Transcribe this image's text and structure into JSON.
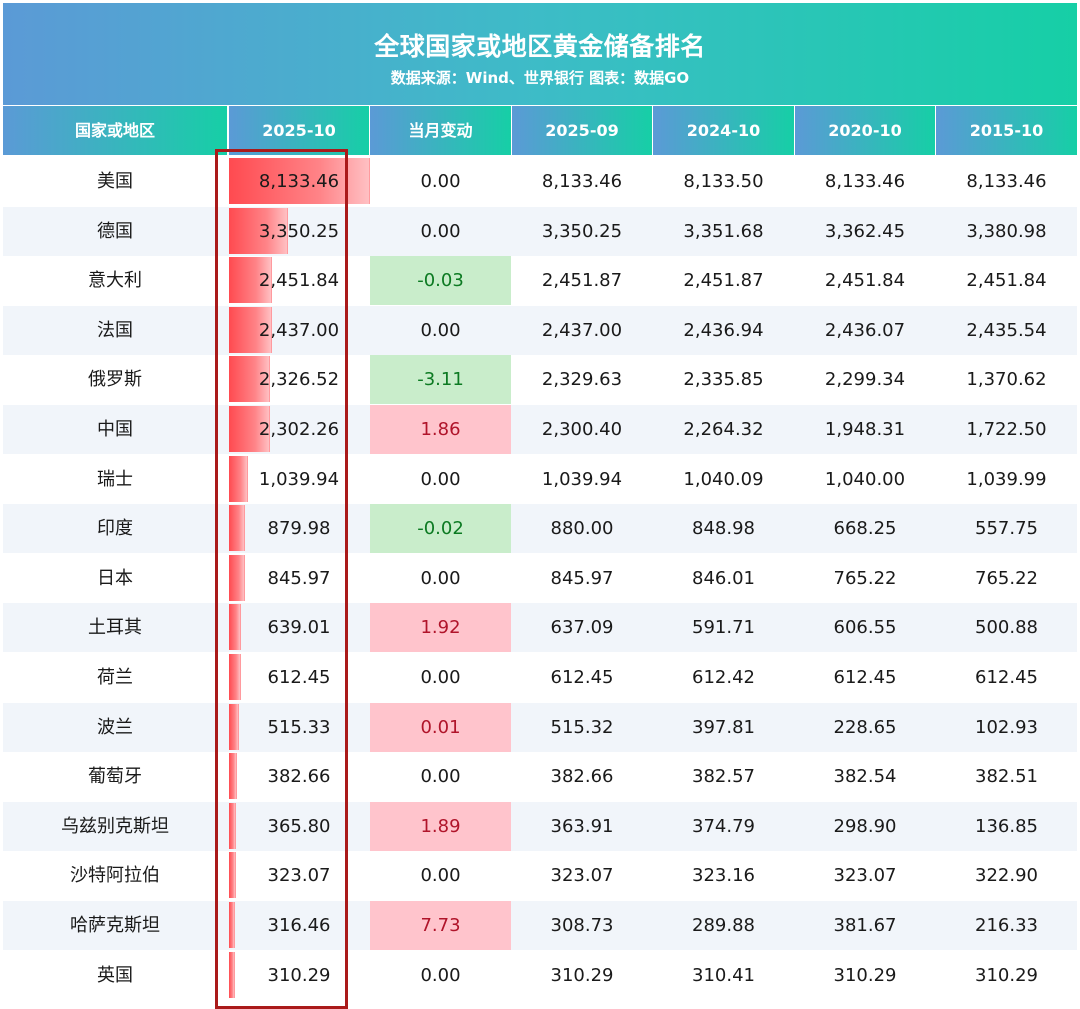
{
  "title": "全球国家或地区黄金储备排名",
  "subtitle": "数据来源：Wind、世界银行 图表：数据GO",
  "colors": {
    "header_gradient_start": "#5b9ad6",
    "header_gradient_end": "#16cfa6",
    "bar": "#ff4a50",
    "positive_change_bg": "#ffc4cc",
    "negative_change_bg": "#c9edcb",
    "highlight_outline": "#aa1a1a"
  },
  "chart_data": {
    "type": "table",
    "columns": [
      "国家或地区",
      "2025-10",
      "当月变动",
      "2025-09",
      "2024-10",
      "2020-10",
      "2015-10"
    ],
    "rows": [
      {
        "country": "美国",
        "v2025_10": "8,133.46",
        "change": "0.00",
        "v2025_09": "8,133.46",
        "v2024_10": "8,133.50",
        "v2020_10": "8,133.46",
        "v2015_10": "8,133.46"
      },
      {
        "country": "德国",
        "v2025_10": "3,350.25",
        "change": "0.00",
        "v2025_09": "3,350.25",
        "v2024_10": "3,351.68",
        "v2020_10": "3,362.45",
        "v2015_10": "3,380.98"
      },
      {
        "country": "意大利",
        "v2025_10": "2,451.84",
        "change": "-0.03",
        "v2025_09": "2,451.87",
        "v2024_10": "2,451.87",
        "v2020_10": "2,451.84",
        "v2015_10": "2,451.84"
      },
      {
        "country": "法国",
        "v2025_10": "2,437.00",
        "change": "0.00",
        "v2025_09": "2,437.00",
        "v2024_10": "2,436.94",
        "v2020_10": "2,436.07",
        "v2015_10": "2,435.54"
      },
      {
        "country": "俄罗斯",
        "v2025_10": "2,326.52",
        "change": "-3.11",
        "v2025_09": "2,329.63",
        "v2024_10": "2,335.85",
        "v2020_10": "2,299.34",
        "v2015_10": "1,370.62"
      },
      {
        "country": "中国",
        "v2025_10": "2,302.26",
        "change": "1.86",
        "v2025_09": "2,300.40",
        "v2024_10": "2,264.32",
        "v2020_10": "1,948.31",
        "v2015_10": "1,722.50"
      },
      {
        "country": "瑞士",
        "v2025_10": "1,039.94",
        "change": "0.00",
        "v2025_09": "1,039.94",
        "v2024_10": "1,040.09",
        "v2020_10": "1,040.00",
        "v2015_10": "1,039.99"
      },
      {
        "country": "印度",
        "v2025_10": "879.98",
        "change": "-0.02",
        "v2025_09": "880.00",
        "v2024_10": "848.98",
        "v2020_10": "668.25",
        "v2015_10": "557.75"
      },
      {
        "country": "日本",
        "v2025_10": "845.97",
        "change": "0.00",
        "v2025_09": "845.97",
        "v2024_10": "846.01",
        "v2020_10": "765.22",
        "v2015_10": "765.22"
      },
      {
        "country": "土耳其",
        "v2025_10": "639.01",
        "change": "1.92",
        "v2025_09": "637.09",
        "v2024_10": "591.71",
        "v2020_10": "606.55",
        "v2015_10": "500.88"
      },
      {
        "country": "荷兰",
        "v2025_10": "612.45",
        "change": "0.00",
        "v2025_09": "612.45",
        "v2024_10": "612.42",
        "v2020_10": "612.45",
        "v2015_10": "612.45"
      },
      {
        "country": "波兰",
        "v2025_10": "515.33",
        "change": "0.01",
        "v2025_09": "515.32",
        "v2024_10": "397.81",
        "v2020_10": "228.65",
        "v2015_10": "102.93"
      },
      {
        "country": "葡萄牙",
        "v2025_10": "382.66",
        "change": "0.00",
        "v2025_09": "382.66",
        "v2024_10": "382.57",
        "v2020_10": "382.54",
        "v2015_10": "382.51"
      },
      {
        "country": "乌兹别克斯坦",
        "v2025_10": "365.80",
        "change": "1.89",
        "v2025_09": "363.91",
        "v2024_10": "374.79",
        "v2020_10": "298.90",
        "v2015_10": "136.85"
      },
      {
        "country": "沙特阿拉伯",
        "v2025_10": "323.07",
        "change": "0.00",
        "v2025_09": "323.07",
        "v2024_10": "323.16",
        "v2020_10": "323.07",
        "v2015_10": "322.90"
      },
      {
        "country": "哈萨克斯坦",
        "v2025_10": "316.46",
        "change": "7.73",
        "v2025_09": "308.73",
        "v2024_10": "289.88",
        "v2020_10": "381.67",
        "v2015_10": "216.33"
      },
      {
        "country": "英国",
        "v2025_10": "310.29",
        "change": "0.00",
        "v2025_09": "310.29",
        "v2024_10": "310.41",
        "v2020_10": "310.29",
        "v2015_10": "310.29"
      }
    ]
  }
}
